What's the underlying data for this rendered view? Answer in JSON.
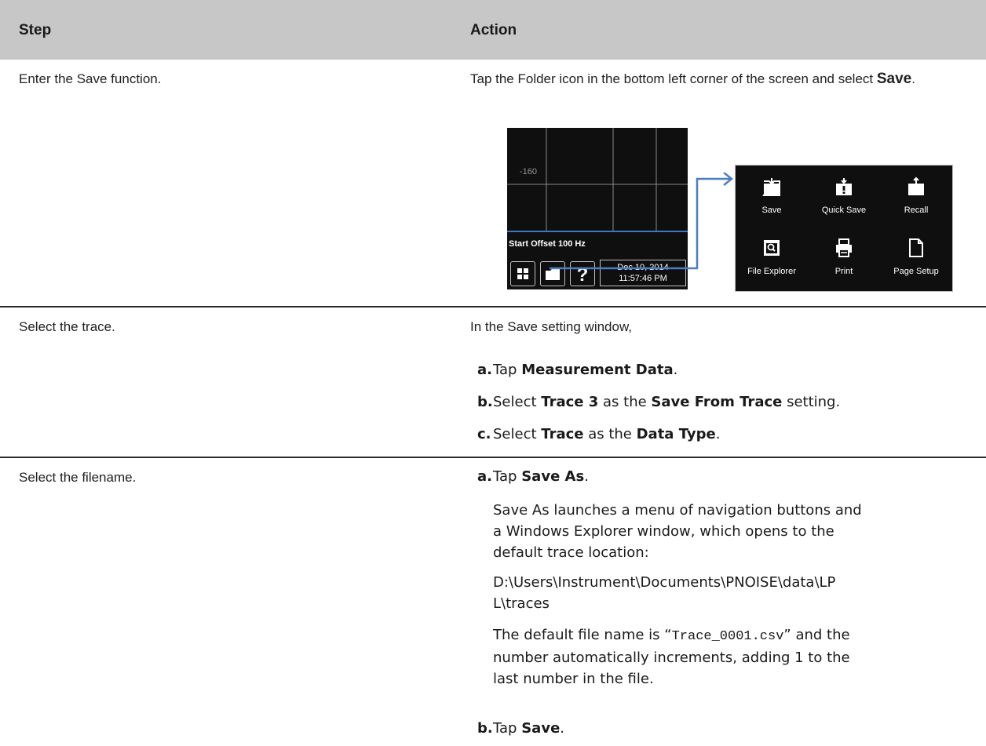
{
  "table": {
    "header": {
      "step": "Step",
      "action": "Action"
    },
    "row1": {
      "step": "Enter the Save function.",
      "action_text": "Tap the Folder icon in the bottom left corner of the screen and select",
      "action_bold": "Save",
      "action_end": "."
    },
    "screenshot_left": {
      "ytick": "-160",
      "start_offset": "Start Offset 100 Hz",
      "date": "Dec 10, 2014",
      "time": "11:57:46 PM"
    },
    "screenshot_right": {
      "items": [
        "Save",
        "Quick Save",
        "Recall",
        "File Explorer",
        "Print",
        "Page Setup"
      ]
    },
    "row2": {
      "step": "Select the trace.",
      "intro": "In the Save setting window,",
      "a": {
        "marker": "a.",
        "t1": "Tap",
        "b1": "Measurement Data",
        "t2": "."
      },
      "b": {
        "marker": "b.",
        "t1": "Select",
        "b1": "Trace 3",
        "t2": "as the",
        "b2": "Save From Trace",
        "t3": "setting."
      },
      "c": {
        "marker": "c.",
        "t1": "Select",
        "b1": "Trace",
        "t2": "as the",
        "b2": "Data Type",
        "t3": "."
      }
    },
    "row3": {
      "step": "Select the filename.",
      "a": {
        "marker": "a.",
        "t1": "Tap",
        "b1": "Save As",
        "t2": "."
      },
      "para1_l1": "Save As launches a menu of navigation buttons and",
      "para1_l2": "a Windows Explorer window, which opens to the",
      "para1_l3": "default trace location:",
      "path_l1": "D:\\Users\\Instrument\\Documents\\PNOISE\\data\\LP",
      "path_l2": "L\\traces",
      "para2_l1a": "The default file name is “",
      "para2_l1code": "Trace_0001.csv",
      "para2_l1b": "” and the",
      "para2_l2": "number automatically increments, adding 1 to the",
      "para2_l3": "last number in the file.",
      "b": {
        "marker": "b.",
        "t1": "Tap",
        "b1": "Save",
        "t2": "."
      }
    }
  }
}
